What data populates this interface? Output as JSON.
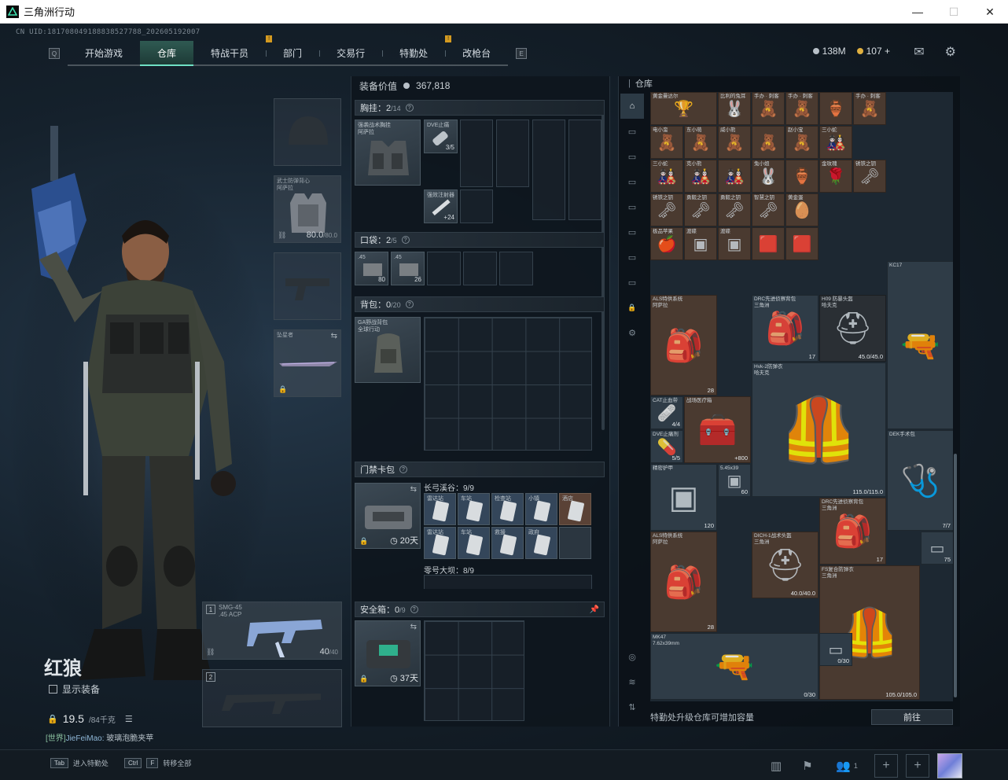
{
  "window": {
    "title": "三角洲行动",
    "controls": [
      "—",
      "☐",
      "✕"
    ]
  },
  "uid": "CN UID:181708049188838527788_202605192007",
  "nav": {
    "tabs": [
      {
        "label": "开始游戏",
        "active": false,
        "badge": ""
      },
      {
        "label": "仓库",
        "active": true,
        "badge": ""
      },
      {
        "label": "特战干员",
        "active": false,
        "badge": "!"
      },
      {
        "label": "部门",
        "active": false,
        "badge": ""
      },
      {
        "label": "交易行",
        "active": false,
        "badge": ""
      },
      {
        "label": "特勤处",
        "active": false,
        "badge": "!"
      },
      {
        "label": "改枪台",
        "active": false,
        "badge": ""
      }
    ]
  },
  "currency": {
    "silver": "138M",
    "gold": "107",
    "gold_add": "+",
    "silver_color": "#b8c0c8",
    "gold_color": "#e0b040"
  },
  "top_icons": [
    "mail-icon",
    "gear-icon"
  ],
  "character": {
    "name": "红狼",
    "show_gear_label": "显示装备",
    "weight": "19.5",
    "weight_max": "/84千克",
    "chat_channel": "[世界]",
    "chat_user": "JieFeiMao:",
    "chat_text": "玻璃泡脆夹苹"
  },
  "equip_slots": {
    "armor_label": "武士防弹背心\n阿萨拉",
    "armor_val": "80.0",
    "armor_max": "/80.0",
    "melee_label": "坠星者",
    "weapon1_num": "1",
    "weapon1_name": "SMG-45",
    "weapon1_sub": ".45 ACP",
    "weapon1_ammo": "40",
    "weapon1_ammo_max": "/40",
    "weapon2_num": "2"
  },
  "center": {
    "value_label": "装备价值",
    "value": "367,818",
    "chest": {
      "title": "胸挂：",
      "count": "2",
      "max": "/14",
      "rig_label": "强袭战术胸挂\n阿萨拉",
      "items": [
        {
          "label": "DVE止痛",
          "val": "3/5"
        },
        {
          "label": "强效注射器",
          "val": "+24"
        }
      ]
    },
    "pocket": {
      "title": "口袋：",
      "count": "2",
      "max": "/5",
      "items": [
        {
          "label": ".45",
          "val": "80"
        },
        {
          "label": ".45",
          "val": "26"
        }
      ]
    },
    "backpack": {
      "title": "背包：",
      "count": "0",
      "max": "/20",
      "bag_label": "GA野战背包\n全球行动"
    },
    "keycard": {
      "title": "门禁卡包",
      "timer": "20天",
      "zone1": "长弓溪谷：9/9",
      "zone2": "零号大坝：8/9",
      "cards": [
        "雷达站",
        "车站",
        "检查站",
        "小镇",
        "酒店",
        "雷达站",
        "车站",
        "救援",
        "政府",
        ""
      ]
    },
    "safebox": {
      "title": "安全箱：",
      "count": "0",
      "max": "/9",
      "timer": "37天"
    }
  },
  "warehouse": {
    "title": "仓库",
    "footer_text": "特勤处升级仓库可增加容量",
    "footer_button": "前往",
    "items": [
      {
        "label": "黄金曼达尔",
        "val": ""
      },
      {
        "label": "比利的兔耳",
        "val": ""
      },
      {
        "label": "手办 · 刺客",
        "val": ""
      },
      {
        "label": "手办 · 刺客",
        "val": ""
      },
      {
        "label": "",
        "val": ""
      },
      {
        "label": "手办 · 刺客",
        "val": ""
      },
      {
        "label": "电小蛮",
        "val": ""
      },
      {
        "label": "东小萌",
        "val": ""
      },
      {
        "label": "威小熊",
        "val": ""
      },
      {
        "label": "",
        "val": ""
      },
      {
        "label": "赵小宝",
        "val": ""
      },
      {
        "label": "三小蛇",
        "val": ""
      },
      {
        "label": "三小蛇",
        "val": ""
      },
      {
        "label": "克小熊",
        "val": ""
      },
      {
        "label": "",
        "val": ""
      },
      {
        "label": "兔小姐",
        "val": ""
      },
      {
        "label": "",
        "val": ""
      },
      {
        "label": "金玫瑰",
        "val": ""
      },
      {
        "label": "锈铁之钥",
        "val": ""
      },
      {
        "label": "锈铁之钥",
        "val": ""
      },
      {
        "label": "勇毅之钥",
        "val": ""
      },
      {
        "label": "勇毅之钥",
        "val": ""
      },
      {
        "label": "智慧之钥",
        "val": ""
      },
      {
        "label": "黄金蛋",
        "val": ""
      },
      {
        "label": "极品苹果",
        "val": ""
      },
      {
        "label": "渡碟",
        "val": ""
      },
      {
        "label": "渡碟",
        "val": ""
      },
      {
        "label": "",
        "val": ""
      },
      {
        "label": "",
        "val": ""
      },
      {
        "label": "KC17",
        "val": ""
      },
      {
        "label": "5.45x39",
        "val": ""
      },
      {
        "label": "ALS特供系统\n阿萨拉",
        "val": "28"
      },
      {
        "label": "DRC先进侦察背包\n三角洲",
        "val": "17"
      },
      {
        "label": "H09 防暴头盔\n哈夫克",
        "val": "45.0/45.0"
      },
      {
        "label": "Hvk-2防弹衣\n哈夫克",
        "val": "115.0/115.0"
      },
      {
        "label": "CAT止血带",
        "val": "4/4"
      },
      {
        "label": "战场医疗箱",
        "val": "+800"
      },
      {
        "label": "DVE止痛剂",
        "val": "5/5"
      },
      {
        "label": "DEK手术包",
        "val": "7/7"
      },
      {
        "label": "精密护甲",
        "val": "120"
      },
      {
        "label": "5.45x39",
        "val": "60"
      },
      {
        "label": "DRC先进侦察背包\n三角洲",
        "val": "17"
      },
      {
        "label": "ALS特供系统\n阿萨拉",
        "val": "28"
      },
      {
        "label": "DICH-1战术头盔\n三角洲",
        "val": "40.0/40.0"
      },
      {
        "label": "FS复合防弹衣\n三角洲",
        "val": "105.0/105.0"
      },
      {
        "label": "MK47\n7.62x39mm",
        "val": "0/30"
      },
      {
        "label": "",
        "val": "0/30"
      },
      {
        "label": "",
        "val": "75"
      }
    ]
  },
  "bottombar": {
    "hotkey1_key": "Tab",
    "hotkey1_label": "进入特勤处",
    "hotkey2_key": "Ctrl",
    "hotkey2_key2": "F",
    "hotkey2_label": "转移全部",
    "squad_count": "1"
  }
}
